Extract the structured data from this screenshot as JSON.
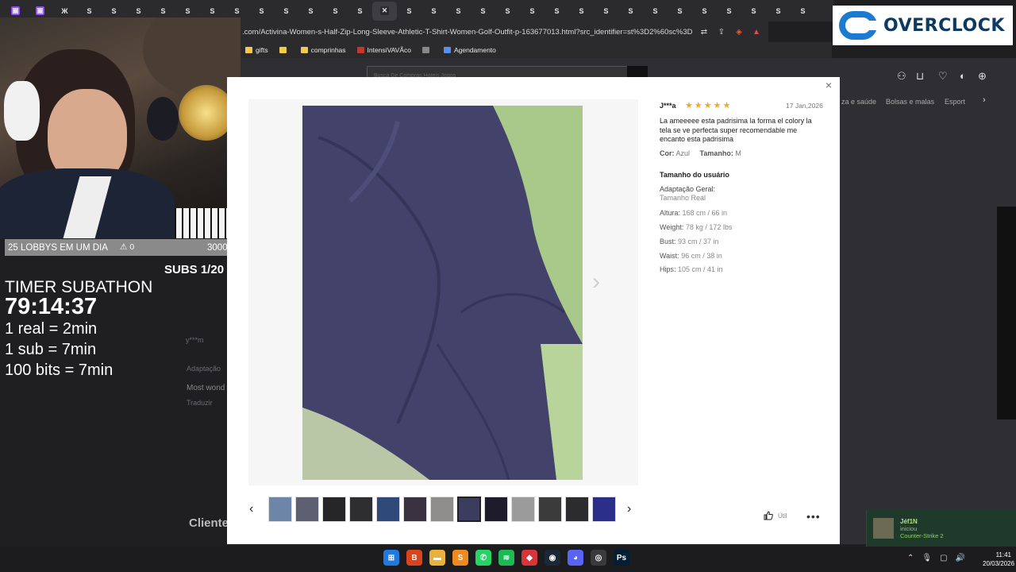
{
  "browser": {
    "tabs": [
      {
        "fav": "▣",
        "color": "#9146ff",
        "label": ""
      },
      {
        "fav": "▣",
        "color": "#9146ff",
        "label": ""
      },
      {
        "fav": "Ж",
        "color": "#2b2b2e",
        "label": ""
      },
      {
        "fav": "S",
        "color": "#2b2b2e",
        "label": ""
      },
      {
        "fav": "S",
        "color": "#2b2b2e",
        "label": ""
      },
      {
        "fav": "S",
        "color": "#2b2b2e",
        "label": ""
      },
      {
        "fav": "S",
        "color": "#2b2b2e",
        "label": ""
      },
      {
        "fav": "S",
        "color": "#2b2b2e",
        "label": ""
      },
      {
        "fav": "S",
        "color": "#2b2b2e",
        "label": ""
      },
      {
        "fav": "S",
        "color": "#2b2b2e",
        "label": ""
      },
      {
        "fav": "S",
        "color": "#2b2b2e",
        "label": ""
      },
      {
        "fav": "S",
        "color": "#2b2b2e",
        "label": ""
      },
      {
        "fav": "S",
        "color": "#2b2b2e",
        "label": ""
      },
      {
        "fav": "S",
        "color": "#2b2b2e",
        "label": ""
      },
      {
        "fav": "S",
        "color": "#2b2b2e",
        "label": ""
      },
      {
        "fav": "✕",
        "color": "#2b2b2e",
        "label": "",
        "active": true
      },
      {
        "fav": "S",
        "color": "#2b2b2e",
        "label": ""
      },
      {
        "fav": "S",
        "color": "#2b2b2e",
        "label": ""
      },
      {
        "fav": "S",
        "color": "#2b2b2e",
        "label": ""
      },
      {
        "fav": "S",
        "color": "#2b2b2e",
        "label": ""
      },
      {
        "fav": "S",
        "color": "#2b2b2e",
        "label": ""
      },
      {
        "fav": "S",
        "color": "#2b2b2e",
        "label": ""
      },
      {
        "fav": "S",
        "color": "#2b2b2e",
        "label": ""
      },
      {
        "fav": "S",
        "color": "#2b2b2e",
        "label": ""
      },
      {
        "fav": "S",
        "color": "#2b2b2e",
        "label": ""
      },
      {
        "fav": "S",
        "color": "#2b2b2e",
        "label": ""
      },
      {
        "fav": "S",
        "color": "#2b2b2e",
        "label": ""
      },
      {
        "fav": "S",
        "color": "#2b2b2e",
        "label": ""
      },
      {
        "fav": "S",
        "color": "#2b2b2e",
        "label": ""
      },
      {
        "fav": "S",
        "color": "#2b2b2e",
        "label": ""
      },
      {
        "fav": "S",
        "color": "#2b2b2e",
        "label": ""
      },
      {
        "fav": "S",
        "color": "#2b2b2e",
        "label": ""
      },
      {
        "fav": "S",
        "color": "#2b2b2e",
        "label": ""
      }
    ],
    "url": ".com/Activina-Women-s-Half-Zip-Long-Sleeve-Athletic-T-Shirt-Women-Golf-Outfit-p-163677013.html?src_identifier=st%3D2%60sc%3D...",
    "bookmarks": [
      {
        "label": "gifts",
        "icon_color": "#f2c94c"
      },
      {
        "label": "",
        "icon_color": "#f2c94c"
      },
      {
        "label": "comprinhas",
        "icon_color": "#f2c94c"
      },
      {
        "label": "IntensiVAVÃco",
        "icon_color": "#c0392b"
      },
      {
        "label": "",
        "icon_color": "#888888"
      },
      {
        "label": "Agendamento",
        "icon_color": "#5b8def"
      }
    ]
  },
  "brand": {
    "logo_text": "OVERCLOCK",
    "logo_color": "#1a7bd0"
  },
  "overlay": {
    "goal_label": "25 LOBBYS EM UM DIA",
    "goal_count": "⚠ 0",
    "goal_target": "30000",
    "subs": "SUBS 1/20",
    "timer_title": "TIMER SUBATHON",
    "timer_value": "79:14:37",
    "rates": [
      "1 real = 2min",
      "1 sub =  7min",
      "100 bits = 7min"
    ]
  },
  "background_page": {
    "search_placeholder": "Busca De Compras Hoteis Jogos",
    "nav": [
      "za e saúde",
      "Bolsas e malas",
      "Esport"
    ],
    "left_texts": [
      "y***m",
      "Most wond",
      "Traduzir",
      "Adaptação"
    ],
    "clients_label": "Cliente"
  },
  "review": {
    "reviewer": "J***a",
    "rating": 5,
    "date": "17 Jan,2026",
    "text": "La ameeeee esta padrisima la forma el colory la tela se ve perfecta super recomendable me encanto esta padrisima",
    "color_label": "Cor:",
    "color_value": "Azul",
    "size_label": "Tamanho:",
    "size_value": "M",
    "user_size_title": "Tamanho do usuário",
    "fit_label": "Adaptação Geral:",
    "fit_value": "Tamanho Real",
    "measurements": [
      {
        "label": "Altura:",
        "value": "168 cm / 66 in"
      },
      {
        "label": "Weight:",
        "value": "78 kg / 172 lbs"
      },
      {
        "label": "Bust:",
        "value": "93 cm / 37 in"
      },
      {
        "label": "Waist:",
        "value": "96 cm / 38 in"
      },
      {
        "label": "Hips:",
        "value": "105 cm / 41 in"
      }
    ],
    "helpful_label": "Útil",
    "more_label": "•••",
    "close_label": "×"
  },
  "gallery": {
    "prev_label": "‹",
    "next_label": "›",
    "big_next_label": "›",
    "thumbnails": [
      {
        "color": "#6d85a6"
      },
      {
        "color": "#5d6070"
      },
      {
        "color": "#262628"
      },
      {
        "color": "#2e2e30"
      },
      {
        "color": "#2f4a78"
      },
      {
        "color": "#3a3240"
      },
      {
        "color": "#8f8c8c"
      },
      {
        "color": "#3c3c5e",
        "selected": true
      },
      {
        "color": "#1e1b2c"
      },
      {
        "color": "#9b9b9b"
      },
      {
        "color": "#3b3b3b"
      },
      {
        "color": "#2c2c2e"
      },
      {
        "color": "#2b2f8a"
      }
    ]
  },
  "notification": {
    "name": "Jéf1N",
    "status": "iniciou",
    "game": "Counter-Strike 2"
  },
  "taskbar": {
    "apps": [
      {
        "name": "windows-start-icon",
        "glyph": "⊞",
        "color": "#1f7ae0"
      },
      {
        "name": "brave-icon",
        "glyph": "B",
        "color": "#d9441c"
      },
      {
        "name": "folder-icon",
        "glyph": "▬",
        "color": "#e8b23a"
      },
      {
        "name": "sublime-icon",
        "glyph": "S",
        "color": "#ef8a1f"
      },
      {
        "name": "whatsapp-icon",
        "glyph": "✆",
        "color": "#25d366"
      },
      {
        "name": "spotify-icon",
        "glyph": "≋",
        "color": "#1db954"
      },
      {
        "name": "app-red-icon",
        "glyph": "◆",
        "color": "#d8343a"
      },
      {
        "name": "steam-icon",
        "glyph": "◉",
        "color": "#1b2838"
      },
      {
        "name": "discord-icon",
        "glyph": "◕",
        "color": "#5865f2"
      },
      {
        "name": "obs-icon",
        "glyph": "◎",
        "color": "#3a3a3a"
      },
      {
        "name": "photoshop-icon",
        "glyph": "Ps",
        "color": "#001e36"
      }
    ],
    "tray": [
      "⌃",
      "🎙",
      "▢",
      "🔊"
    ],
    "time": "11:41",
    "date": "20/03/2026"
  }
}
